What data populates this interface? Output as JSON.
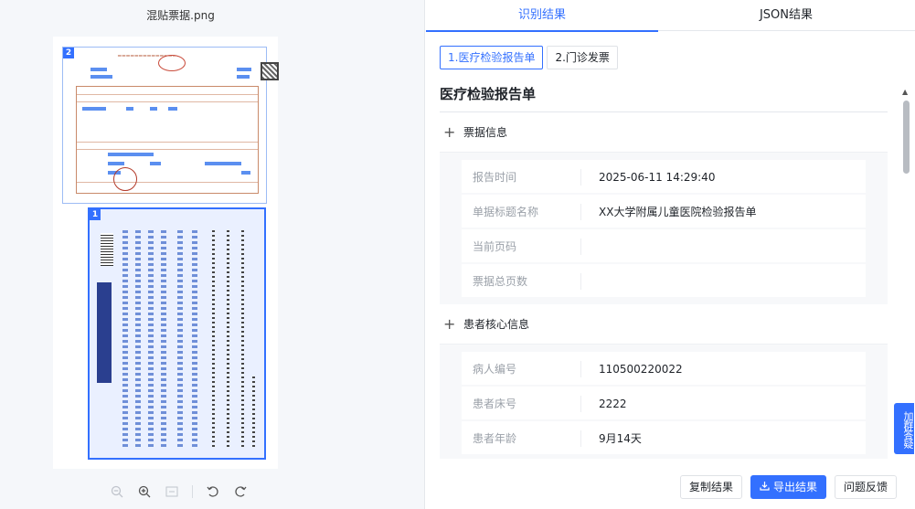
{
  "left": {
    "file_name": "混贴票据.png",
    "docs": [
      {
        "badge": "2"
      },
      {
        "badge": "1"
      }
    ],
    "zoom_icons": [
      "zoom-out-icon",
      "zoom-in-icon",
      "fit-page-icon",
      "rotate-left-icon",
      "rotate-right-icon"
    ]
  },
  "tabs": {
    "result": "识别结果",
    "json": "JSON结果"
  },
  "subtabs": [
    {
      "label": "1.医疗检验报告单"
    },
    {
      "label": "2.门诊发票"
    }
  ],
  "doc_title": "医疗检验报告单",
  "sections": [
    {
      "title": "票据信息",
      "fields": [
        {
          "label": "报告时间",
          "value": "2025-06-11 14:29:40"
        },
        {
          "label": "单据标题名称",
          "value": "XX大学附属儿童医院检验报告单"
        },
        {
          "label": "当前页码",
          "value": ""
        },
        {
          "label": "票据总页数",
          "value": ""
        }
      ]
    },
    {
      "title": "患者核心信息",
      "fields": [
        {
          "label": "病人编号",
          "value": "110500220022"
        },
        {
          "label": "患者床号",
          "value": "2222"
        },
        {
          "label": "患者年龄",
          "value": "9月14天"
        }
      ]
    }
  ],
  "feedback_tab": "加群答疑",
  "actions": {
    "copy": "复制结果",
    "export": "导出结果",
    "feedback": "问题反馈"
  },
  "colors": {
    "accent": "#3370ff"
  }
}
